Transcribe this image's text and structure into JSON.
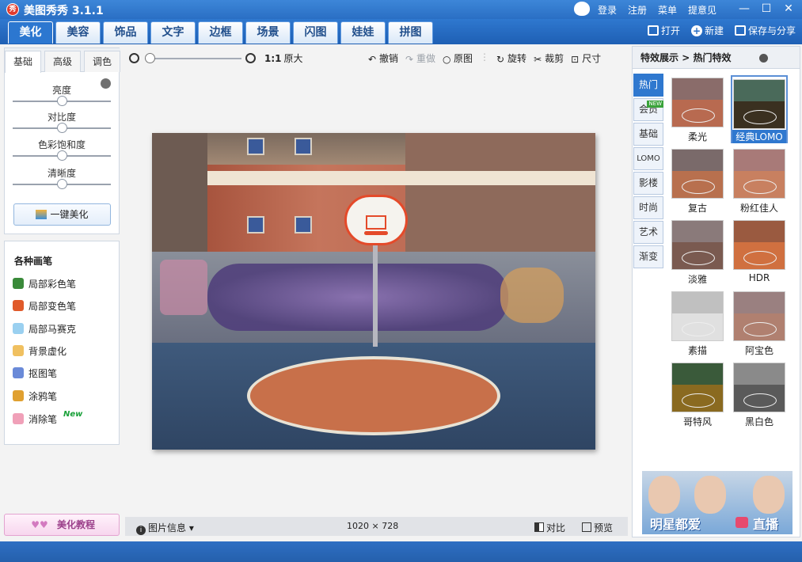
{
  "window": {
    "logo_text": "秀",
    "title": "美图秀秀 3.1.1",
    "top_links": [
      "登录",
      "注册",
      "菜单",
      "提意见"
    ],
    "controls": [
      "—",
      "☐",
      "✕"
    ]
  },
  "menu": {
    "tabs": [
      "美化",
      "美容",
      "饰品",
      "文字",
      "边框",
      "场景",
      "闪图",
      "娃娃",
      "拼图"
    ],
    "active_tab": "美化",
    "actions": [
      "打开",
      "新建",
      "保存与分享"
    ]
  },
  "left_panel": {
    "tabs": [
      "基础",
      "高级",
      "调色"
    ],
    "active_tab": "基础",
    "sliders": [
      {
        "label": "亮度",
        "value": 0.5
      },
      {
        "label": "对比度",
        "value": 0.5
      },
      {
        "label": "色彩饱和度",
        "value": 0.5
      },
      {
        "label": "清晰度",
        "value": 0.5
      }
    ],
    "one_key_button": "一键美化",
    "brush_title": "各种画笔",
    "brushes": [
      {
        "label": "局部彩色笔",
        "icon": "color-brush-icon",
        "color": "#3a8a3a"
      },
      {
        "label": "局部变色笔",
        "icon": "recolor-brush-icon",
        "color": "#e05a2a"
      },
      {
        "label": "局部马赛克",
        "icon": "mosaic-icon",
        "color": "#9ad0f0"
      },
      {
        "label": "背景虚化",
        "icon": "blur-icon",
        "color": "#f0c060"
      },
      {
        "label": "抠图笔",
        "icon": "cutout-icon",
        "color": "#6a8ad8"
      },
      {
        "label": "涂鸦笔",
        "icon": "doodle-icon",
        "color": "#e0a030"
      },
      {
        "label": "消除笔",
        "icon": "eraser-icon",
        "color": "#f0a0b8",
        "badge": "New"
      }
    ],
    "tutorial_button": "美化教程"
  },
  "toolbar": {
    "zoom_value": 0.0,
    "original_size_prefix": "1:1",
    "original_size_label": "原大",
    "undo": "撤销",
    "redo": "重做",
    "original": "原图",
    "rotate": "旋转",
    "crop": "裁剪",
    "resize": "尺寸"
  },
  "status": {
    "image_info": "图片信息",
    "dimensions": "1020 × 728",
    "compare": "对比",
    "preview": "预览"
  },
  "right_panel": {
    "header_title": "特效展示",
    "header_arrow": ">",
    "header_sub": "热门特效",
    "categories": [
      {
        "label": "热门",
        "active": true
      },
      {
        "label": "会员",
        "badge": "NEW"
      },
      {
        "label": "基础"
      },
      {
        "label": "LOMO"
      },
      {
        "label": "影楼"
      },
      {
        "label": "时尚"
      },
      {
        "label": "艺术"
      },
      {
        "label": "渐变"
      }
    ],
    "effects": [
      {
        "label": "柔光",
        "top": "#8a6c6a",
        "bottom": "#b86a50"
      },
      {
        "label": "经典LOMO",
        "top": "#4a6a5a",
        "bottom": "#3a3020",
        "selected": true
      },
      {
        "label": "复古",
        "top": "#7a6a6a",
        "bottom": "#b8704e"
      },
      {
        "label": "粉红佳人",
        "top": "#a87a78",
        "bottom": "#c88060"
      },
      {
        "label": "淡雅",
        "top": "#8a7a7a",
        "bottom": "#7a5a50"
      },
      {
        "label": "HDR",
        "top": "#9a5a40",
        "bottom": "#d07040"
      },
      {
        "label": "素描",
        "top": "#c0c0c0",
        "bottom": "#e0e0e0"
      },
      {
        "label": "阿宝色",
        "top": "#9a8080",
        "bottom": "#b08070"
      },
      {
        "label": "哥特风",
        "top": "#3a5a3a",
        "bottom": "#8a6a20"
      },
      {
        "label": "黑白色",
        "top": "#8a8a8a",
        "bottom": "#5a5a5a"
      }
    ],
    "ad_text": "明星都爱",
    "ad_text2": "直播"
  }
}
